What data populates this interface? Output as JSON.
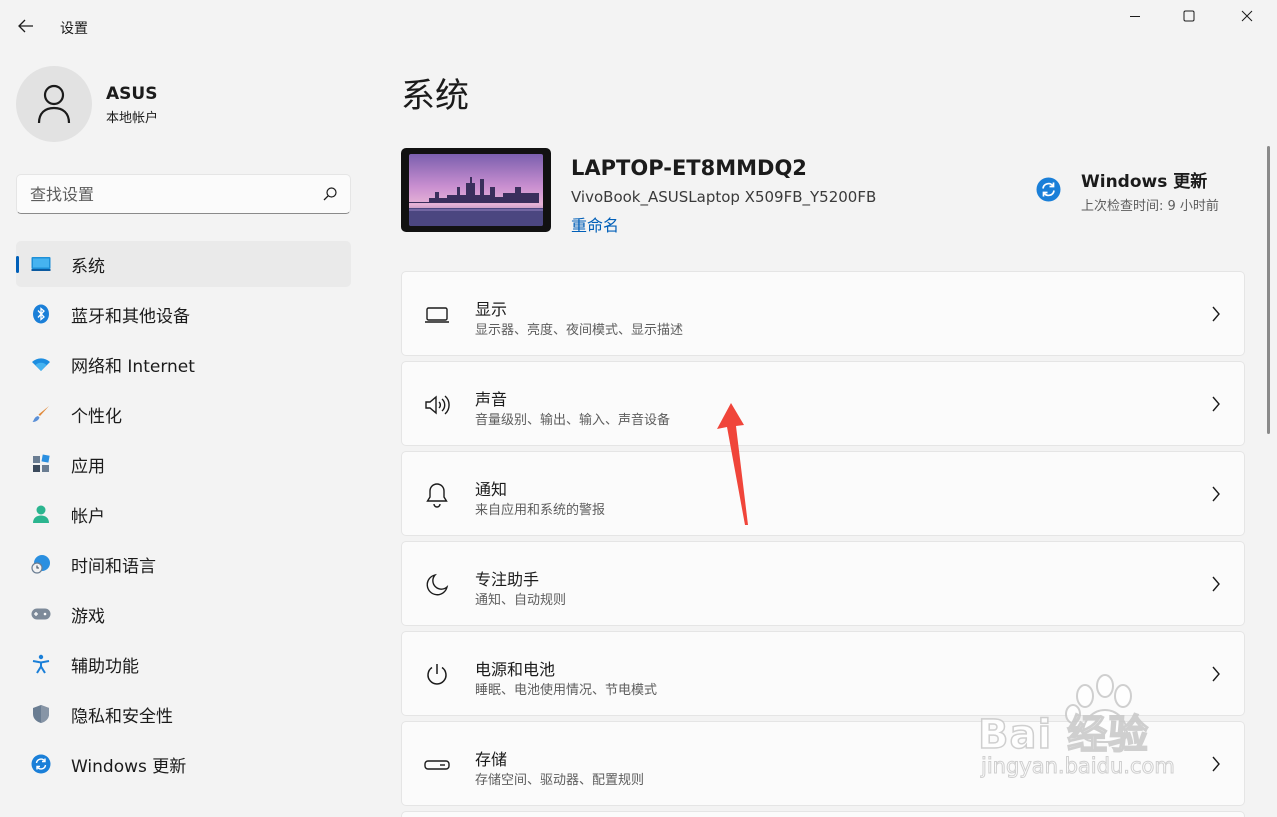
{
  "titlebar": {
    "title": "设置"
  },
  "user": {
    "name": "ASUS",
    "account_type": "本地帐户"
  },
  "search": {
    "placeholder": "查找设置"
  },
  "nav": {
    "items": [
      {
        "label": "系统",
        "icon": "monitor-icon",
        "active": true
      },
      {
        "label": "蓝牙和其他设备",
        "icon": "bluetooth-icon"
      },
      {
        "label": "网络和 Internet",
        "icon": "wifi-icon"
      },
      {
        "label": "个性化",
        "icon": "brush-icon"
      },
      {
        "label": "应用",
        "icon": "apps-icon"
      },
      {
        "label": "帐户",
        "icon": "account-icon"
      },
      {
        "label": "时间和语言",
        "icon": "globe-clock-icon"
      },
      {
        "label": "游戏",
        "icon": "gamepad-icon"
      },
      {
        "label": "辅助功能",
        "icon": "accessibility-icon"
      },
      {
        "label": "隐私和安全性",
        "icon": "shield-icon"
      },
      {
        "label": "Windows 更新",
        "icon": "update-icon"
      }
    ]
  },
  "main": {
    "title": "系统",
    "device": {
      "name": "LAPTOP-ET8MMDQ2",
      "model": "VivoBook_ASUSLaptop X509FB_Y5200FB",
      "rename": "重命名"
    },
    "windows_update": {
      "title": "Windows 更新",
      "subtitle": "上次检查时间: 9 小时前"
    },
    "cards": [
      {
        "title": "显示",
        "subtitle": "显示器、亮度、夜间模式、显示描述",
        "icon": "display-icon"
      },
      {
        "title": "声音",
        "subtitle": "音量级别、输出、输入、声音设备",
        "icon": "speaker-icon"
      },
      {
        "title": "通知",
        "subtitle": "来自应用和系统的警报",
        "icon": "bell-icon"
      },
      {
        "title": "专注助手",
        "subtitle": "通知、自动规则",
        "icon": "moon-icon"
      },
      {
        "title": "电源和电池",
        "subtitle": "睡眠、电池使用情况、节电模式",
        "icon": "power-icon"
      },
      {
        "title": "存储",
        "subtitle": "存储空间、驱动器、配置规则",
        "icon": "storage-icon"
      }
    ]
  },
  "watermark": {
    "main": "Bai 经验",
    "sub": "jingyan.baidu.com"
  },
  "colors": {
    "accent": "#005fb8",
    "annotation_arrow": "#f0453a"
  }
}
